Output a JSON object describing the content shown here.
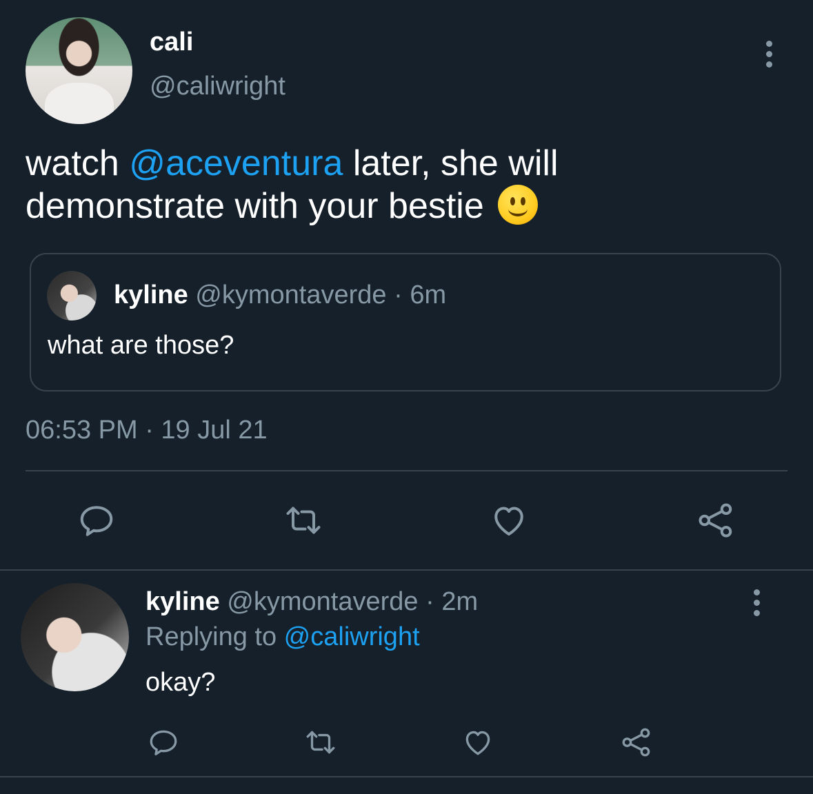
{
  "tweet": {
    "author_name": "cali",
    "author_handle": "@caliwright",
    "text_before": "watch ",
    "mention": "@aceventura",
    "text_after": " later, she will demonstrate with your bestie",
    "emoji_icon": "slightly-smiling-face-icon",
    "timestamp": "06:53 PM · 19 Jul 21"
  },
  "quoted_tweet": {
    "author_name": "kyline",
    "author_handle": "@kymontaverde",
    "time_ago": " · 6m",
    "text": "what are those?"
  },
  "actions": [
    "reply-icon",
    "retweet-icon",
    "like-icon",
    "share-icon"
  ],
  "reply": {
    "author_name": "kyline",
    "author_handle": "@kymontaverde",
    "time_ago": " · 2m",
    "replying_to_label": "Replying to ",
    "replying_to_handle": "@caliwright",
    "text": "okay?"
  },
  "colors": {
    "background": "#15202b",
    "divider": "#38444d",
    "secondary_text": "#8899a6",
    "link": "#1da1f2"
  }
}
